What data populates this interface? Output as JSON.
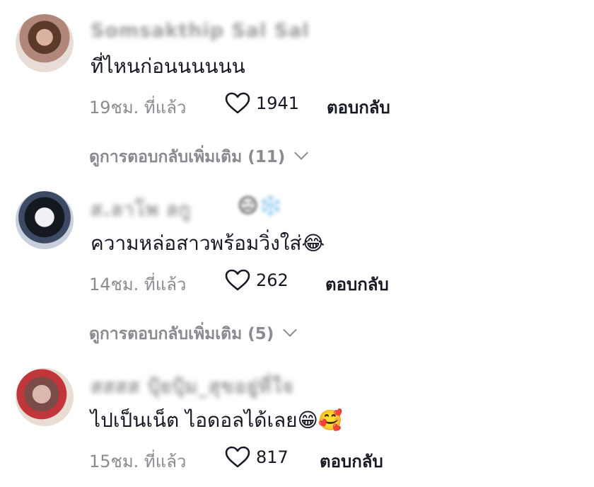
{
  "comments": [
    {
      "username": "Somsakthip Sal Sal",
      "text": "ที่ไหนก่อนนนนนน",
      "time": "19ชม. ที่แล้ว",
      "likes": "1941",
      "reply_label": "ตอบกลับ",
      "view_replies": "ดูการตอบกลับเพิ่มเติม (11)"
    },
    {
      "username": "ส.ลาโพ ลกู",
      "username_emoji": "😑❄️",
      "text": "ความหล่อสาวพร้อมวิ่งใส่😂",
      "time": "14ชม. ที่แล้ว",
      "likes": "262",
      "reply_label": "ตอบกลับ",
      "view_replies": "ดูการตอบกลับเพิ่มเติม (5)"
    },
    {
      "username": "สสสส ปุ้ยปุ้ม_สุขอยู่ที่ใจ",
      "text": "ไปเป็นเน็ต ไอดอลได้เลย😁🥰",
      "time": "15ชม. ที่แล้ว",
      "likes": "817",
      "reply_label": "ตอบกลับ"
    }
  ],
  "icons": {
    "like": "heart-outline-icon",
    "expand": "chevron-down-icon"
  },
  "colors": {
    "text": "#161823",
    "secondary": "#8a8b91",
    "background": "#ffffff"
  }
}
